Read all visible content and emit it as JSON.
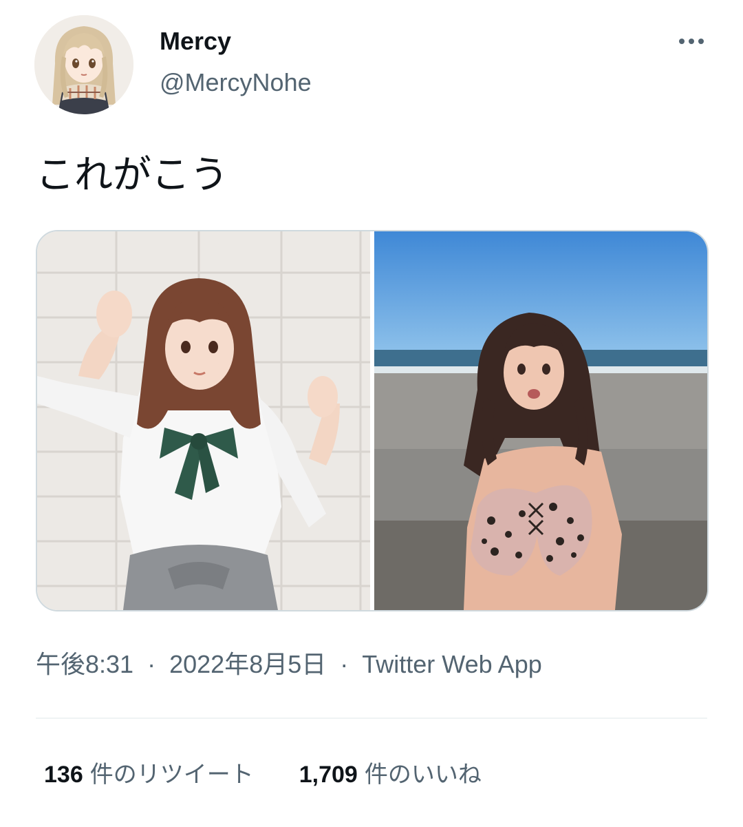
{
  "tweet": {
    "author": {
      "display_name": "Mercy",
      "handle": "@MercyNohe"
    },
    "text": "これがこう",
    "meta": {
      "time": "午後8:31",
      "separator": "·",
      "date": "2022年8月5日",
      "source": "Twitter Web App"
    },
    "stats": {
      "retweets_count": "136",
      "retweets_label": "件のリツイート",
      "likes_count": "1,709",
      "likes_label": "件のいいね"
    }
  },
  "icons": {
    "more": "more-horizontal-icon"
  },
  "colors": {
    "primary_text": "#0f1419",
    "secondary_text": "#536471",
    "border": "#cfd9de",
    "divider": "#eff3f4"
  }
}
